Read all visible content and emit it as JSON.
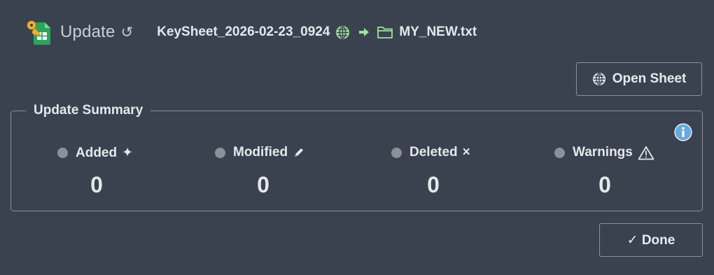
{
  "header": {
    "title": "Update",
    "refresh_glyph": "↺",
    "source_name": "KeySheet_2026-02-23_0924",
    "target_name": "MY_NEW.txt",
    "icons": {
      "logo": "key-sheet-logo-icon",
      "refresh": "refresh-icon",
      "source": "globe-icon",
      "arrow": "arrow-right-icon",
      "target": "folder-icon"
    }
  },
  "toolbar": {
    "open_sheet_label": "Open Sheet",
    "done_label": "✓ Done"
  },
  "summary": {
    "title": "Update Summary",
    "stats": [
      {
        "label": "Added",
        "glyph": "✦",
        "value": "0"
      },
      {
        "label": "Modified",
        "glyph": "pencil",
        "value": "0"
      },
      {
        "label": "Deleted",
        "glyph": "×",
        "value": "0"
      },
      {
        "label": "Warnings",
        "glyph": "warning",
        "value": "0"
      }
    ]
  },
  "colors": {
    "background": "#3a4250",
    "text": "#e4e7ec",
    "muted": "#8c9099",
    "accent_green": "#9ee39a",
    "info_blue": "#6aa8e0"
  }
}
